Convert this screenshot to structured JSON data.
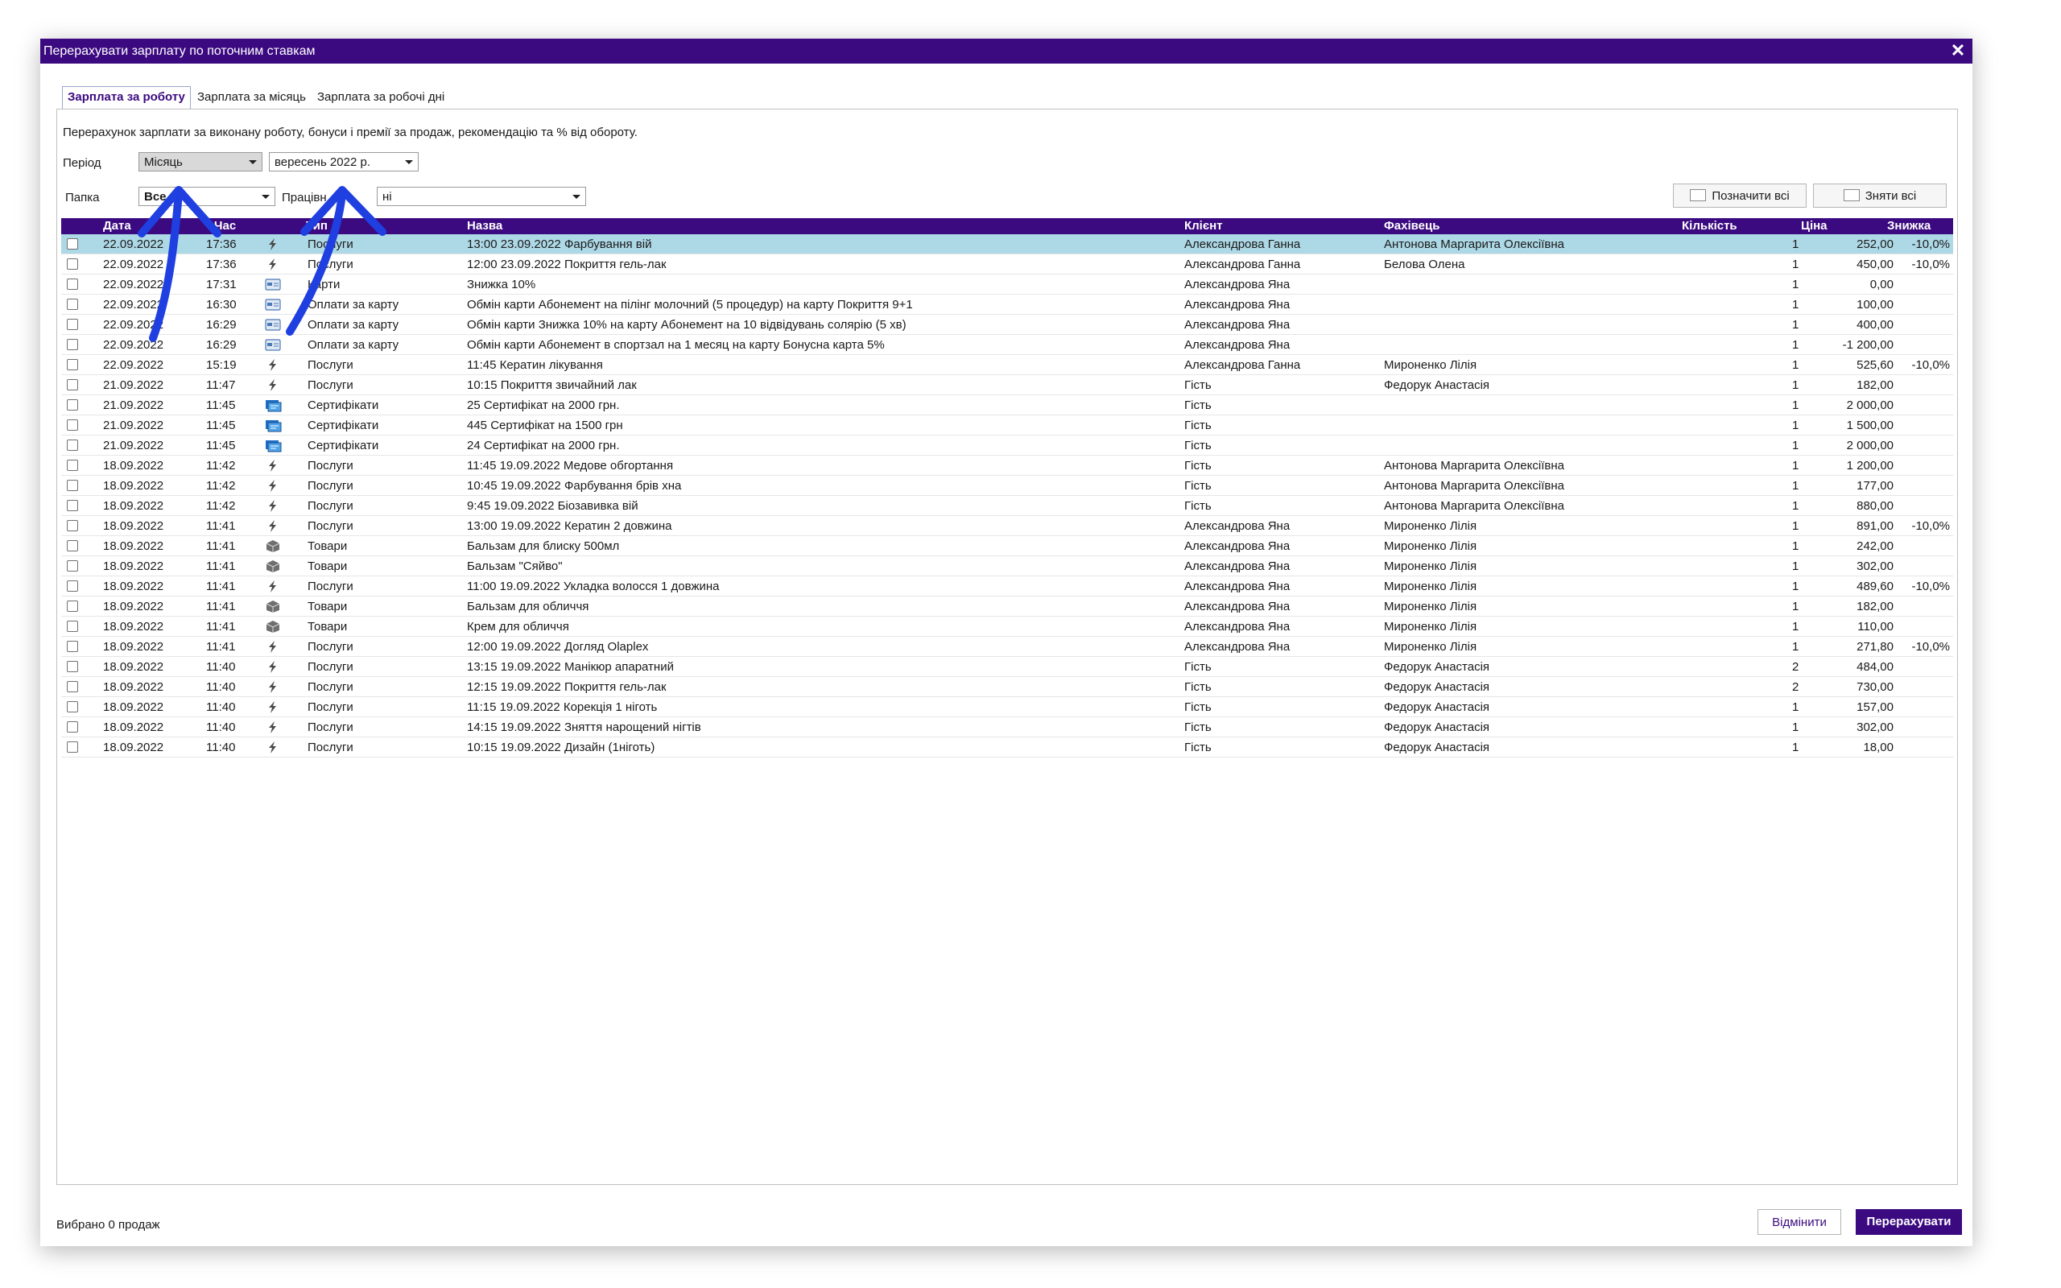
{
  "colors": {
    "accent": "#3b0a80",
    "selected_row": "#add8e6",
    "annotation_arrow": "#1f3fe0"
  },
  "window": {
    "title": "Перерахувати зарплату по поточним ставкам",
    "close_icon": "close-icon"
  },
  "tabs": [
    {
      "label": "Зарплата за роботу",
      "active": true
    },
    {
      "label": "Зарплата за місяць",
      "active": false
    },
    {
      "label": "Зарплата за робочі дні",
      "active": false
    }
  ],
  "description": "Перерахунок зарплати за виконану роботу, бонуси і премії за продаж, рекомендацію та % від обороту.",
  "filters": {
    "period_label": "Період",
    "period_value": "Місяць",
    "month_value": "вересень  2022 р.",
    "folder_label": "Папка",
    "folder_value": "Все",
    "employee_label": "Працівн",
    "employee_value": "ні"
  },
  "buttons": {
    "mark_all": "Позначити всі",
    "unmark_all": "Зняти всі",
    "cancel": "Відмінити",
    "recalculate": "Перерахувати"
  },
  "grid": {
    "columns": [
      "Дата",
      "Час",
      "Тип",
      "Назва",
      "Клієнт",
      "Фахівець",
      "Кількість",
      "Ціна",
      "Знижка"
    ],
    "rows": [
      {
        "date": "22.09.2022",
        "time": "17:36",
        "icon": "lightning-icon",
        "type": "Послуги",
        "name": "13:00 23.09.2022 Фарбування вій",
        "client": "Александрова Ганна",
        "specialist": "Антонова Маргарита Олексіївна",
        "qty": "1",
        "price": "252,00",
        "discount": "-10,0%",
        "selected": true
      },
      {
        "date": "22.09.2022",
        "time": "17:36",
        "icon": "lightning-icon",
        "type": "Послуги",
        "name": "12:00 23.09.2022 Покриття гель-лак",
        "client": "Александрова Ганна",
        "specialist": "Белова Олена",
        "qty": "1",
        "price": "450,00",
        "discount": "-10,0%"
      },
      {
        "date": "22.09.2022",
        "time": "17:31",
        "icon": "card-icon",
        "type": "Карти",
        "name": "Знижка 10%",
        "client": "Александрова Яна",
        "specialist": "",
        "qty": "1",
        "price": "0,00",
        "discount": ""
      },
      {
        "date": "22.09.2022",
        "time": "16:30",
        "icon": "card-icon",
        "type": "Оплати за карту",
        "name": "Обмін карти Абонемент на пілінг молочний (5 процедур) на карту Покриття 9+1",
        "client": "Александрова Яна",
        "specialist": "",
        "qty": "1",
        "price": "100,00",
        "discount": ""
      },
      {
        "date": "22.09.2022",
        "time": "16:29",
        "icon": "card-icon",
        "type": "Оплати за карту",
        "name": "Обмін карти Знижка 10% на карту Абонемент на 10 відвідувань солярію (5 хв)",
        "client": "Александрова Яна",
        "specialist": "",
        "qty": "1",
        "price": "400,00",
        "discount": ""
      },
      {
        "date": "22.09.2022",
        "time": "16:29",
        "icon": "card-icon",
        "type": "Оплати за карту",
        "name": "Обмін карти Абонемент в спортзал на 1 месяц на карту Бонусна карта 5%",
        "client": "Александрова Яна",
        "specialist": "",
        "qty": "1",
        "price": "-1 200,00",
        "discount": ""
      },
      {
        "date": "22.09.2022",
        "time": "15:19",
        "icon": "lightning-icon",
        "type": "Послуги",
        "name": "11:45 Кератин лікування",
        "client": "Александрова Ганна",
        "specialist": "Мироненко Лілія",
        "qty": "1",
        "price": "525,60",
        "discount": "-10,0%"
      },
      {
        "date": "21.09.2022",
        "time": "11:47",
        "icon": "lightning-icon",
        "type": "Послуги",
        "name": "10:15 Покриття звичайний лак",
        "client": "Гість",
        "specialist": "Федорук Анастасія",
        "qty": "1",
        "price": "182,00",
        "discount": ""
      },
      {
        "date": "21.09.2022",
        "time": "11:45",
        "icon": "certificate-icon",
        "type": "Сертифікати",
        "name": "25 Сертифікат на 2000 грн.",
        "client": "Гість",
        "specialist": "",
        "qty": "1",
        "price": "2 000,00",
        "discount": ""
      },
      {
        "date": "21.09.2022",
        "time": "11:45",
        "icon": "certificate-icon",
        "type": "Сертифікати",
        "name": "445 Сертифікат на 1500 грн",
        "client": "Гість",
        "specialist": "",
        "qty": "1",
        "price": "1 500,00",
        "discount": ""
      },
      {
        "date": "21.09.2022",
        "time": "11:45",
        "icon": "certificate-icon",
        "type": "Сертифікати",
        "name": "24 Сертифікат на 2000 грн.",
        "client": "Гість",
        "specialist": "",
        "qty": "1",
        "price": "2 000,00",
        "discount": ""
      },
      {
        "date": "18.09.2022",
        "time": "11:42",
        "icon": "lightning-icon",
        "type": "Послуги",
        "name": "11:45 19.09.2022 Медове обгортання",
        "client": "Гість",
        "specialist": "Антонова Маргарита Олексіївна",
        "qty": "1",
        "price": "1 200,00",
        "discount": ""
      },
      {
        "date": "18.09.2022",
        "time": "11:42",
        "icon": "lightning-icon",
        "type": "Послуги",
        "name": "10:45 19.09.2022 Фарбування брів хна",
        "client": "Гість",
        "specialist": "Антонова Маргарита Олексіївна",
        "qty": "1",
        "price": "177,00",
        "discount": ""
      },
      {
        "date": "18.09.2022",
        "time": "11:42",
        "icon": "lightning-icon",
        "type": "Послуги",
        "name": "9:45 19.09.2022 Біозавивка вій",
        "client": "Гість",
        "specialist": "Антонова Маргарита Олексіївна",
        "qty": "1",
        "price": "880,00",
        "discount": ""
      },
      {
        "date": "18.09.2022",
        "time": "11:41",
        "icon": "lightning-icon",
        "type": "Послуги",
        "name": "13:00 19.09.2022 Кератин 2 довжина",
        "client": "Александрова Яна",
        "specialist": "Мироненко Лілія",
        "qty": "1",
        "price": "891,00",
        "discount": "-10,0%"
      },
      {
        "date": "18.09.2022",
        "time": "11:41",
        "icon": "box-icon",
        "type": "Товари",
        "name": "Бальзам для блиску 500мл",
        "client": "Александрова Яна",
        "specialist": "Мироненко Лілія",
        "qty": "1",
        "price": "242,00",
        "discount": ""
      },
      {
        "date": "18.09.2022",
        "time": "11:41",
        "icon": "box-icon",
        "type": "Товари",
        "name": "Бальзам \"Сяйво\"",
        "client": "Александрова Яна",
        "specialist": "Мироненко Лілія",
        "qty": "1",
        "price": "302,00",
        "discount": ""
      },
      {
        "date": "18.09.2022",
        "time": "11:41",
        "icon": "lightning-icon",
        "type": "Послуги",
        "name": "11:00 19.09.2022 Укладка волосся 1 довжина",
        "client": "Александрова Яна",
        "specialist": "Мироненко Лілія",
        "qty": "1",
        "price": "489,60",
        "discount": "-10,0%"
      },
      {
        "date": "18.09.2022",
        "time": "11:41",
        "icon": "box-icon",
        "type": "Товари",
        "name": "Бальзам для обличчя",
        "client": "Александрова Яна",
        "specialist": "Мироненко Лілія",
        "qty": "1",
        "price": "182,00",
        "discount": ""
      },
      {
        "date": "18.09.2022",
        "time": "11:41",
        "icon": "box-icon",
        "type": "Товари",
        "name": "Крем для обличчя",
        "client": "Александрова Яна",
        "specialist": "Мироненко Лілія",
        "qty": "1",
        "price": "110,00",
        "discount": ""
      },
      {
        "date": "18.09.2022",
        "time": "11:41",
        "icon": "lightning-icon",
        "type": "Послуги",
        "name": "12:00 19.09.2022 Догляд Olaplex",
        "client": "Александрова Яна",
        "specialist": "Мироненко Лілія",
        "qty": "1",
        "price": "271,80",
        "discount": "-10,0%"
      },
      {
        "date": "18.09.2022",
        "time": "11:40",
        "icon": "lightning-icon",
        "type": "Послуги",
        "name": "13:15 19.09.2022 Манікюр апаратний",
        "client": "Гість",
        "specialist": "Федорук Анастасія",
        "qty": "2",
        "price": "484,00",
        "discount": ""
      },
      {
        "date": "18.09.2022",
        "time": "11:40",
        "icon": "lightning-icon",
        "type": "Послуги",
        "name": "12:15 19.09.2022 Покриття гель-лак",
        "client": "Гість",
        "specialist": "Федорук Анастасія",
        "qty": "2",
        "price": "730,00",
        "discount": ""
      },
      {
        "date": "18.09.2022",
        "time": "11:40",
        "icon": "lightning-icon",
        "type": "Послуги",
        "name": "11:15 19.09.2022 Корекція 1 ніготь",
        "client": "Гість",
        "specialist": "Федорук Анастасія",
        "qty": "1",
        "price": "157,00",
        "discount": ""
      },
      {
        "date": "18.09.2022",
        "time": "11:40",
        "icon": "lightning-icon",
        "type": "Послуги",
        "name": "14:15 19.09.2022 Зняття нарощений нігтів",
        "client": "Гість",
        "specialist": "Федорук Анастасія",
        "qty": "1",
        "price": "302,00",
        "discount": ""
      },
      {
        "date": "18.09.2022",
        "time": "11:40",
        "icon": "lightning-icon",
        "type": "Послуги",
        "name": "10:15 19.09.2022 Дизайн (1ніготь)",
        "client": "Гість",
        "specialist": "Федорук Анастасія",
        "qty": "1",
        "price": "18,00",
        "discount": ""
      }
    ]
  },
  "status": "Вибрано 0 продаж"
}
